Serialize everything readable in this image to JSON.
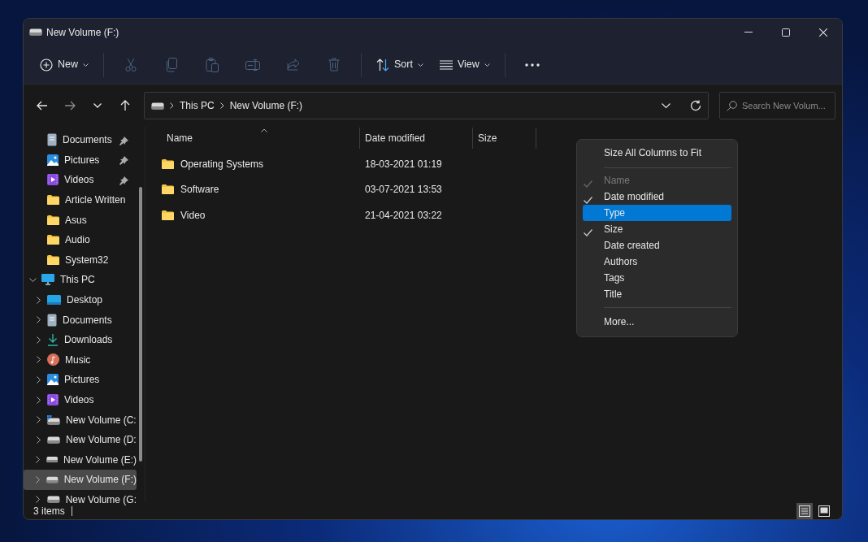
{
  "window": {
    "title": "New Volume (F:)"
  },
  "toolbar": [
    {
      "kind": "new",
      "label": "New",
      "disabled": false,
      "dropdown": true
    },
    {
      "kind": "separator"
    },
    {
      "kind": "cut",
      "disabled": true
    },
    {
      "kind": "copy",
      "disabled": true
    },
    {
      "kind": "paste",
      "disabled": true
    },
    {
      "kind": "rename",
      "disabled": true
    },
    {
      "kind": "share",
      "disabled": true
    },
    {
      "kind": "delete",
      "disabled": true
    },
    {
      "kind": "separator"
    },
    {
      "kind": "sort",
      "label": "Sort",
      "disabled": false,
      "dropdown": true
    },
    {
      "kind": "view",
      "label": "View",
      "disabled": false,
      "dropdown": true
    },
    {
      "kind": "separator"
    },
    {
      "kind": "more",
      "disabled": false
    }
  ],
  "navigation": {
    "back_disabled": false,
    "forward_disabled": true
  },
  "address": {
    "breadcrumbs": [
      "This PC",
      "New Volume (F:)"
    ]
  },
  "search": {
    "placeholder": "Search New Volum..."
  },
  "sidebar": {
    "items": [
      {
        "label": "Documents",
        "kind": "documents",
        "pinned": true,
        "selected": false
      },
      {
        "label": "Pictures",
        "kind": "pictures",
        "pinned": true,
        "selected": false
      },
      {
        "label": "Videos",
        "kind": "videos",
        "pinned": true,
        "selected": false
      },
      {
        "label": "Article Written",
        "kind": "folder",
        "pinned": false,
        "selected": false
      },
      {
        "label": "Asus",
        "kind": "folder",
        "pinned": false,
        "selected": false
      },
      {
        "label": "Audio",
        "kind": "folder",
        "pinned": false,
        "selected": false
      },
      {
        "label": "System32",
        "kind": "folder",
        "pinned": false,
        "selected": false
      },
      {
        "label": "This PC",
        "kind": "pc",
        "expanded": true,
        "selected": false,
        "children": [
          {
            "label": "Desktop",
            "kind": "desktop",
            "expanded": false,
            "selected": false
          },
          {
            "label": "Documents",
            "kind": "documents",
            "expanded": false,
            "selected": false
          },
          {
            "label": "Downloads",
            "kind": "downloads",
            "expanded": false,
            "selected": false
          },
          {
            "label": "Music",
            "kind": "music",
            "expanded": false,
            "selected": false
          },
          {
            "label": "Pictures",
            "kind": "pictures",
            "expanded": false,
            "selected": false
          },
          {
            "label": "Videos",
            "kind": "videos",
            "expanded": false,
            "selected": false
          },
          {
            "label": "New Volume (C:",
            "kind": "system-drive",
            "expanded": false,
            "selected": false
          },
          {
            "label": "New Volume (D:",
            "kind": "drive",
            "expanded": false,
            "selected": false
          },
          {
            "label": "New Volume (E:)",
            "kind": "drive",
            "expanded": false,
            "selected": false
          },
          {
            "label": "New Volume (F:)",
            "kind": "drive",
            "expanded": false,
            "selected": true
          },
          {
            "label": "New Volume (G:",
            "kind": "drive",
            "expanded": false,
            "selected": false
          }
        ]
      }
    ]
  },
  "table": {
    "columns": [
      {
        "label": "Name",
        "sorted": true
      },
      {
        "label": "Date modified",
        "sorted": false
      },
      {
        "label": "Size",
        "sorted": false
      }
    ],
    "rows": [
      {
        "name": "Operating Systems",
        "date_modified": "18-03-2021 01:19"
      },
      {
        "name": "Software",
        "date_modified": "03-07-2021 13:53"
      },
      {
        "name": "Video",
        "date_modified": "21-04-2021 03:22"
      }
    ]
  },
  "context_menu": {
    "items": [
      {
        "kind": "command",
        "label": "Size All Columns to Fit"
      },
      {
        "kind": "separator"
      },
      {
        "kind": "column",
        "label": "Name",
        "checked": true,
        "disabled": true,
        "selected": false
      },
      {
        "kind": "column",
        "label": "Date modified",
        "checked": true,
        "disabled": false,
        "selected": false
      },
      {
        "kind": "column",
        "label": "Type",
        "checked": false,
        "disabled": false,
        "selected": true
      },
      {
        "kind": "column",
        "label": "Size",
        "checked": true,
        "disabled": false,
        "selected": false
      },
      {
        "kind": "column",
        "label": "Date created",
        "checked": false,
        "disabled": false,
        "selected": false
      },
      {
        "kind": "column",
        "label": "Authors",
        "checked": false,
        "disabled": false,
        "selected": false
      },
      {
        "kind": "column",
        "label": "Tags",
        "checked": false,
        "disabled": false,
        "selected": false
      },
      {
        "kind": "column",
        "label": "Title",
        "checked": false,
        "disabled": false,
        "selected": false
      },
      {
        "kind": "separator"
      },
      {
        "kind": "command",
        "label": "More..."
      }
    ]
  },
  "status_bar": {
    "item_count": "3 items",
    "views": [
      {
        "kind": "details",
        "selected": true
      },
      {
        "kind": "tiles",
        "selected": false
      }
    ]
  }
}
